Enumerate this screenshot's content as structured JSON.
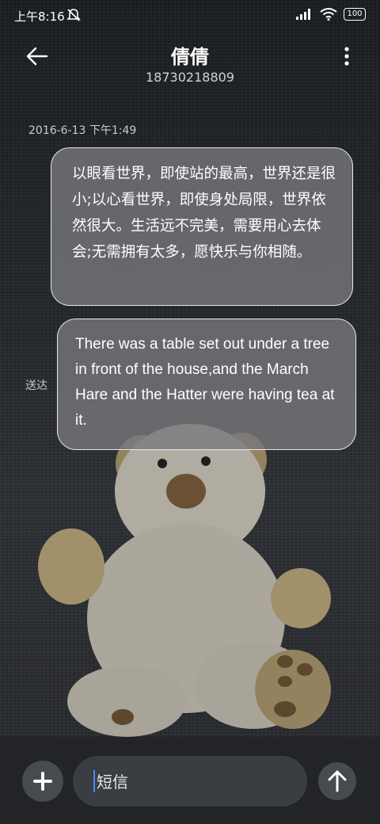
{
  "status_bar": {
    "time": "上午8:16",
    "battery": "100",
    "icons": [
      "mute-icon",
      "signal-icon",
      "wifi-icon",
      "battery-icon"
    ]
  },
  "header": {
    "contact_name": "倩倩",
    "phone_number": "18730218809",
    "icons": [
      "back-arrow-icon",
      "more-options-icon"
    ]
  },
  "conversation": {
    "timestamp": "2016-6-13 下午1:49",
    "messages": [
      {
        "text": "以眼看世界，即使站的最高，世界还是很小;以心看世界，即使身处局限，世界依然很大。生活远不完美，需要用心去体会;无需拥有太多，愿快乐与你相随。"
      },
      {
        "text": "There was a table set out under a tree in front of the house,and the March Hare and the Hatter were having tea at it."
      }
    ],
    "delivery_status": "送达"
  },
  "input_bar": {
    "placeholder": "短信",
    "icons": [
      "plus-icon",
      "send-arrow-icon"
    ]
  },
  "colors": {
    "bubble": "#7a7c80",
    "input_bar": "#222428",
    "caret": "#4c8cf5"
  }
}
